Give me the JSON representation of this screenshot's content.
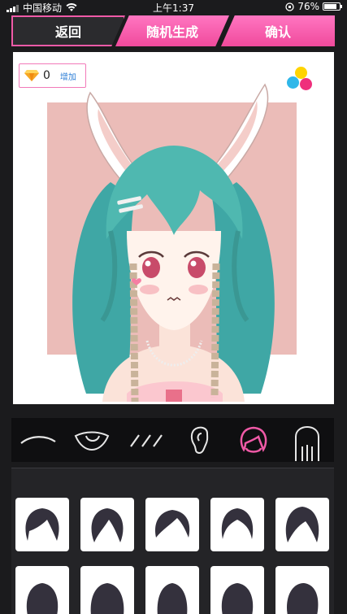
{
  "status_bar": {
    "carrier": "中国移动",
    "time": "上午1:37",
    "battery": "76%"
  },
  "nav": {
    "back_label": "返回",
    "random_label": "随机生成",
    "confirm_label": "确认"
  },
  "gems": {
    "count": "0",
    "add_label": "增加"
  },
  "colors": {
    "accent": "#f05aa7",
    "hair": "#4fb8b0",
    "portrait_bg": "#ebbcb8"
  },
  "categories": [
    "eyebrow-icon",
    "eye-icon",
    "eyelash-icon",
    "ear-icon",
    "hair-icon",
    "back-hair-icon"
  ],
  "selected_category": "hair-icon",
  "hair_items_visible": 10
}
